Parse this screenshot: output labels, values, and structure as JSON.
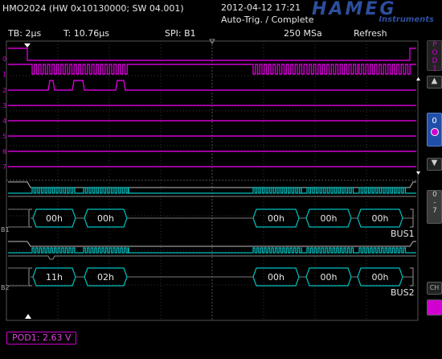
{
  "header": {
    "model": "HMO2024 (HW 0x10130000; SW 04.001)",
    "datetime": "2012-04-12 17:21",
    "status": "Auto-Trig. / Complete",
    "logo_main": "HAMEG",
    "logo_sub": "Instruments"
  },
  "info": {
    "timebase": "TB: 2µs",
    "trigger_time": "T: 10.76µs",
    "trigger_source": "SPI: B1",
    "sample_rate": "250 MSa",
    "acq_mode": "Refresh"
  },
  "channels": {
    "digital": [
      "0",
      "1",
      "2",
      "3",
      "4",
      "5",
      "6",
      "7"
    ],
    "bus1_marker": "B1",
    "bus2_marker": "B2"
  },
  "bus1": {
    "name": "BUS1",
    "values": [
      "00h",
      "00h",
      "00h",
      "00h",
      "00h"
    ]
  },
  "bus2": {
    "name": "BUS2",
    "values": [
      "11h",
      "02h",
      "00h",
      "00h",
      "00h"
    ]
  },
  "side_panel": {
    "pod_label": "POD1",
    "pod_bit": "0",
    "range_label": "0-7",
    "ch_label": "CH"
  },
  "footer": {
    "threshold": "POD1: 2.63 V"
  },
  "colors": {
    "digital": "#d000d0",
    "bus": "#00c0c0",
    "grid": "#3a3a3a",
    "logo": "#2d4e9e"
  }
}
